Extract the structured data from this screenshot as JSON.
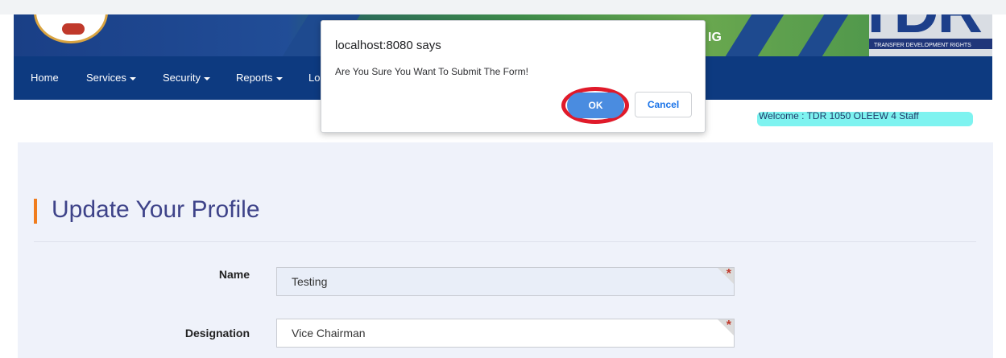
{
  "banner": {
    "partial_text": "IG",
    "logo_letters": "TDR",
    "logo_tagline": "TRANSFER DEVELOPMENT RIGHTS"
  },
  "nav": {
    "items": [
      {
        "label": "Home",
        "dropdown": false
      },
      {
        "label": "Services",
        "dropdown": true
      },
      {
        "label": "Security",
        "dropdown": true
      },
      {
        "label": "Reports",
        "dropdown": true
      },
      {
        "label": "Lo",
        "dropdown": false
      }
    ]
  },
  "welcome": {
    "text": "Welcome : TDR 1050 OLEEW 4 Staff"
  },
  "page": {
    "title": "Update Your Profile"
  },
  "form": {
    "fields": [
      {
        "label": "Name",
        "value": "Testing",
        "required": true
      },
      {
        "label": "Designation",
        "value": "Vice Chairman",
        "required": true
      }
    ]
  },
  "dialog": {
    "title": "localhost:8080 says",
    "message": "Are You Sure You Want To Submit The Form!",
    "ok_label": "OK",
    "cancel_label": "Cancel"
  },
  "colors": {
    "nav_bg": "#0d3a80",
    "title_accent": "#f07d1e",
    "ok_button": "#4a8ce0",
    "highlight_ring": "#e01a2a",
    "required_star": "#c0392b"
  }
}
